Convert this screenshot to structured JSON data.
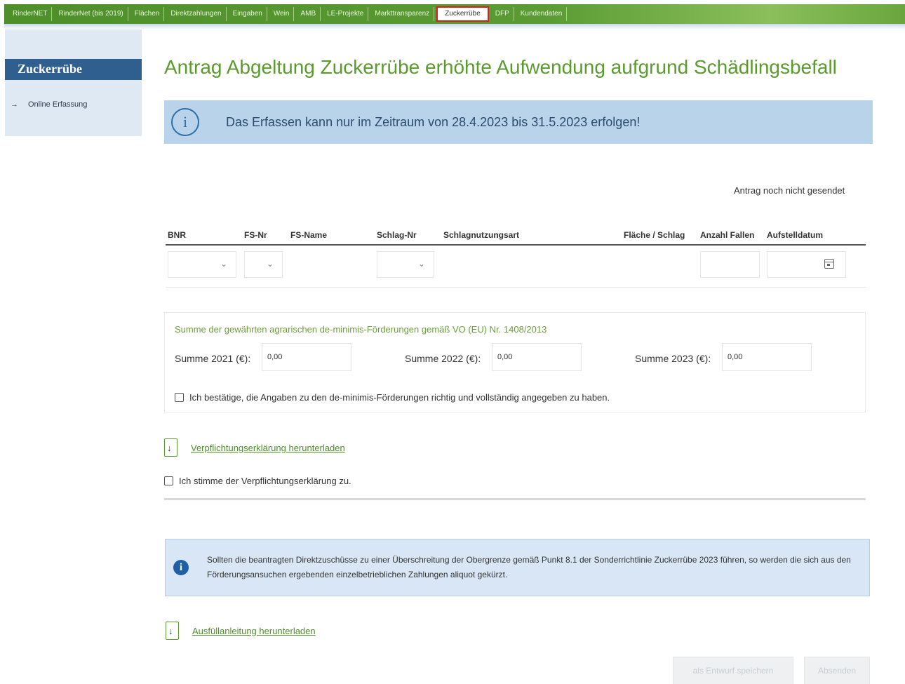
{
  "topnav": {
    "tabs": [
      {
        "label": "RinderNET"
      },
      {
        "label": "RinderNet (bis 2019)"
      },
      {
        "label": "Flächen"
      },
      {
        "label": "Direktzahlungen"
      },
      {
        "label": "Eingaben"
      },
      {
        "label": "Wein"
      },
      {
        "label": "AMB"
      },
      {
        "label": "LE-Projekte"
      },
      {
        "label": "Markttransparenz"
      },
      {
        "label": "Zuckerrübe"
      },
      {
        "label": "DFP"
      },
      {
        "label": "Kundendaten"
      }
    ],
    "active_index": 9
  },
  "sidebar": {
    "title": "Zuckerrübe",
    "items": [
      {
        "label": "Online Erfassung",
        "icon": "arrow-right-icon"
      }
    ]
  },
  "main": {
    "title": "Antrag Abgeltung Zuckerrübe erhöhte Aufwendung aufgrund Schädlingsbefall",
    "info_banner": "Das Erfassen kann nur im Zeitraum von 28.4.2023 bis 31.5.2023 erfolgen!",
    "status": "Antrag noch nicht gesendet",
    "table": {
      "columns": [
        "BNR",
        "FS-Nr",
        "FS-Name",
        "Schlag-Nr",
        "Schlagnutzungsart",
        "Fläche / Schlag",
        "Anzahl Fallen",
        "Aufstelldatum"
      ]
    },
    "deminimis": {
      "title": "Summe der gewährten agrarischen de-minimis-Förderungen gemäß VO (EU) Nr. 1408/2013",
      "fields": [
        {
          "label": "Summe 2021 (€):",
          "value": "0,00"
        },
        {
          "label": "Summe 2022 (€):",
          "value": "0,00"
        },
        {
          "label": "Summe 2023 (€):",
          "value": "0,00"
        }
      ],
      "confirm_label": "Ich bestätige, die Angaben zu den de-minimis-Förderungen richtig und vollständig angegeben zu haben."
    },
    "download_obligation": "Verpflichtungserklärung herunterladen",
    "agree_label": "Ich stimme der Verpflichtungserklärung zu.",
    "notice": "Sollten die beantragten Direktzuschüsse zu einer Überschreitung der Obergrenze gemäß Punkt 8.1 der Sonderrichtlinie Zuckerrübe 2023 führen, so werden die sich aus den Förderungsansuchen ergebenden einzelbetrieblichen Zahlungen aliquot gekürzt.",
    "download_guide": "Ausfüllanleitung herunterladen",
    "buttons": {
      "save_draft": "als Entwurf speichern",
      "submit": "Absenden"
    }
  }
}
